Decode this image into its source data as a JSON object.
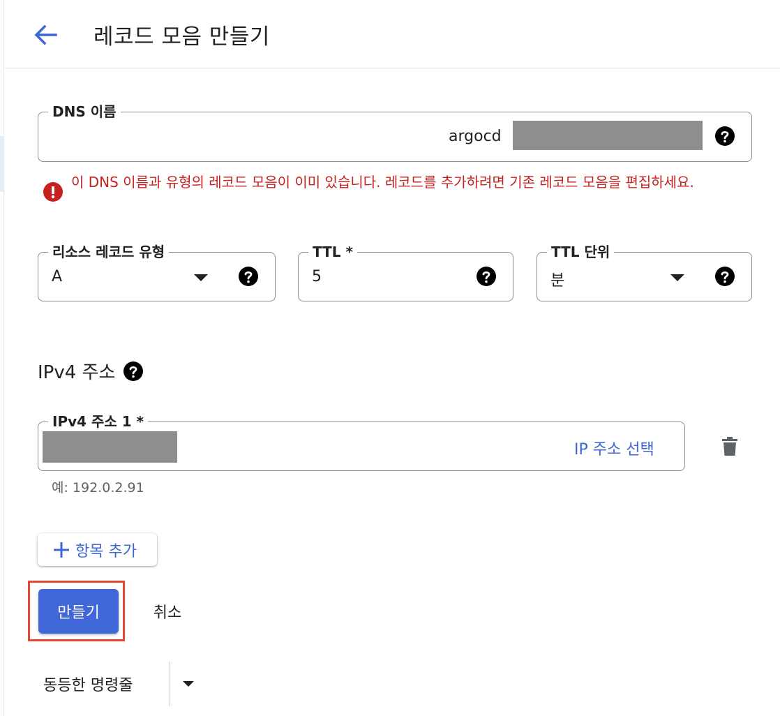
{
  "header": {
    "title": "레코드 모음 만들기"
  },
  "dns_name": {
    "label": "DNS 이름",
    "value": "argocd"
  },
  "error": {
    "message": "이 DNS 이름과 유형의 레코드 모음이 이미 있습니다. 레코드를 추가하려면 기존 레코드 모음을 편집하세요."
  },
  "record_type": {
    "label": "리소스 레코드 유형",
    "value": "A"
  },
  "ttl": {
    "label": "TTL *",
    "value": "5"
  },
  "ttl_unit": {
    "label": "TTL 단위",
    "value": "분"
  },
  "ipv4": {
    "section_title": "IPv4 주소",
    "field_label": "IPv4 주소 1 *",
    "select_link": "IP 주소 선택",
    "hint": "예: 192.0.2.91"
  },
  "add_item": {
    "label": "항목 추가"
  },
  "actions": {
    "create": "만들기",
    "cancel": "취소"
  },
  "command_line": {
    "label": "동등한 명령줄"
  },
  "colors": {
    "accent": "#3f67d8",
    "error": "#c5221f",
    "highlight_border": "#e2492f"
  }
}
